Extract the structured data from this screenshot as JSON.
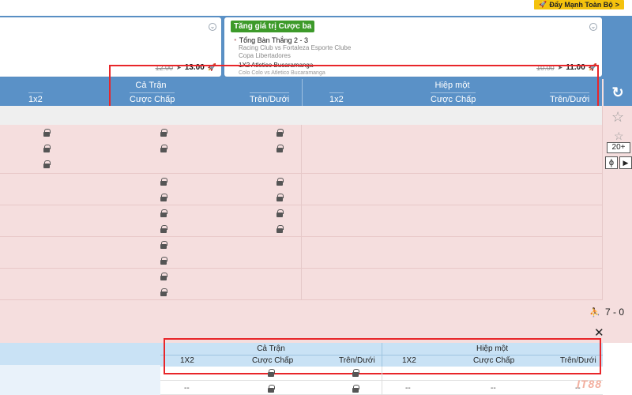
{
  "top_bar": {
    "boost_button": "Đẩy Mạnh Toàn Bộ",
    "boost_arrow": ">"
  },
  "cards": [
    {
      "old_price": "12.00",
      "new_price": "13.00"
    },
    {
      "tag": "Tăng giá trị Cược ba",
      "line1": "Tổng Bàn Thắng 2 - 3",
      "line2": "Racing Club vs Fortaleza Esporte Clube",
      "line3": "Copa Libertadores",
      "line4": "1X2 Atletico Bucaramanga",
      "line5": "Colo Colo vs Atletico Bucaramanga",
      "old_price": "10.00",
      "new_price": "11.00"
    }
  ],
  "header": {
    "full_match": "Cả Trận",
    "first_half": "Hiệp một",
    "cols": [
      "1x2",
      "Cược Chấp",
      "Trên/Dưới",
      "1x2",
      "Cược Chấp",
      "Trên/Dưới"
    ]
  },
  "rail": {
    "refresh_icon": "↻",
    "star": "☆",
    "more_markets": "20+",
    "stats_icon": "ϕ",
    "play_icon": "▶"
  },
  "score": {
    "value": "7 - 0"
  },
  "close_label": "✕",
  "bottom_header": {
    "full_match": "Cả Trận",
    "first_half": "Hiệp một",
    "cols": [
      "1X2",
      "Cược Chấp",
      "Trên/Dưới",
      "1X2",
      "Cược Chấp",
      "Trên/Dưới"
    ]
  },
  "bottom_dashes": [
    "--",
    "--",
    "--",
    "--"
  ],
  "watermark": "IT88",
  "colors": {
    "header_blue": "#5a91c7",
    "row_pink": "#f5dede",
    "highlight_red": "#e8262a",
    "promo_green": "#3d9a2a",
    "boost_yellow": "#f4c20d"
  }
}
